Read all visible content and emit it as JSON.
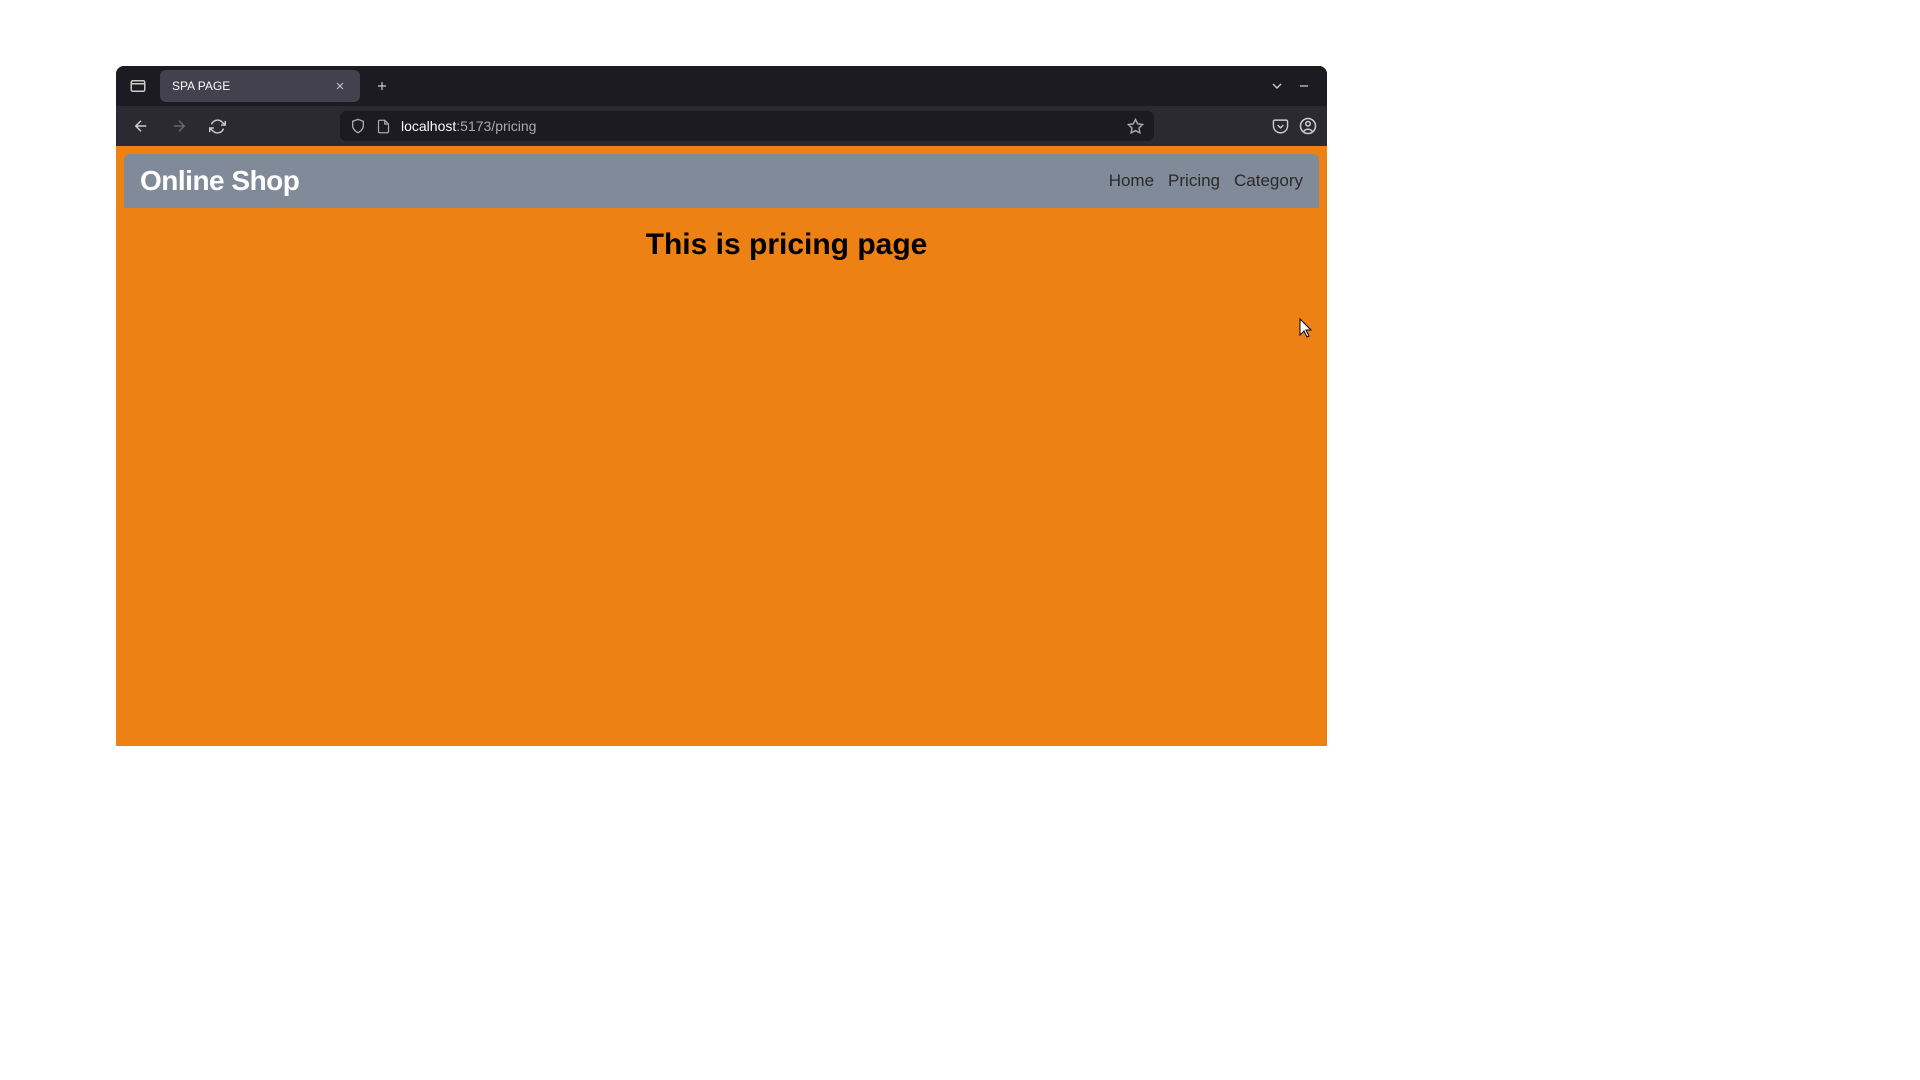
{
  "browser": {
    "tab_title": "SPA PAGE",
    "url_domain": "localhost",
    "url_port_path": ":5173/pricing"
  },
  "page": {
    "site_title": "Online Shop",
    "nav": {
      "home": "Home",
      "pricing": "Pricing",
      "category": "Category"
    },
    "heading": "This is pricing page"
  }
}
